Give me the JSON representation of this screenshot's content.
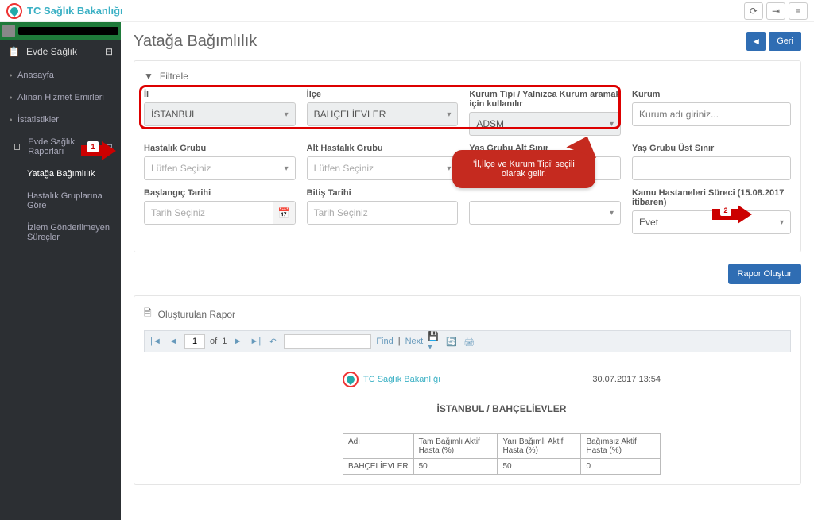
{
  "brand": "TC Sağlık Bakanlığı",
  "top": {
    "refresh": "⟳",
    "exit": "⇥",
    "menu": "≡"
  },
  "sidebar": {
    "section": "Evde Sağlık",
    "items": [
      "Anasayfa",
      "Alınan Hizmet Emirleri",
      "İstatistikler"
    ],
    "reports_head": "Evde Sağlık Raporları",
    "reports": [
      "Yatağa Bağımlılık",
      "Hastalık Gruplarına Göre",
      "İzlem Gönderilmeyen Süreçler"
    ]
  },
  "page": {
    "title": "Yatağa Bağımlılık",
    "back": "Geri"
  },
  "filter": {
    "head": "Filtrele",
    "il_lbl": "İl",
    "il_val": "İSTANBUL",
    "ilce_lbl": "İlçe",
    "ilce_val": "BAHÇELİEVLER",
    "tip_lbl": "Kurum Tipi / Yalnızca Kurum aramak için kullanılır",
    "tip_val": "ADSM",
    "kurum_lbl": "Kurum",
    "kurum_ph": "Kurum adı giriniz...",
    "hgrup_lbl": "Hastalık Grubu",
    "hgrup_ph": "Lütfen Seçiniz",
    "ahgrup_lbl": "Alt Hastalık Grubu",
    "ahgrup_ph": "Lütfen Seçiniz",
    "yas_alt_lbl": "Yaş Grubu Alt Sınır",
    "yas_ust_lbl": "Yaş Grubu Üst Sınır",
    "bas_lbl": "Başlangıç Tarihi",
    "bas_ph": "Tarih Seçiniz",
    "bit_lbl": "Bitiş Tarihi",
    "bit_ph": "Tarih Seçiniz",
    "kamu_lbl": "Kamu Hastaneleri Süreci (15.08.2017 itibaren)",
    "kamu_val": "Evet",
    "btn": "Rapor Oluştur"
  },
  "callout": {
    "line1": "'İl,İlçe ve Kurum Tipi' seçili",
    "line2": "olarak gelir."
  },
  "marker1": "1",
  "marker2": "2",
  "report": {
    "head": "Oluşturulan Rapor",
    "toolbar": {
      "of": "of",
      "total": "1",
      "page": "1",
      "find": "Find",
      "next": "Next"
    },
    "brand": "TC Sağlık Bakanlığı",
    "timestamp": "30.07.2017 13:54",
    "title": "İSTANBUL / BAHÇELİEVLER"
  },
  "chart_data": {
    "type": "table",
    "columns": [
      "Adı",
      "Tam Bağımlı Aktif Hasta (%)",
      "Yarı Bağımlı Aktif Hasta (%)",
      "Bağımsız Aktif Hasta (%)"
    ],
    "rows": [
      {
        "Adı": "BAHÇELİEVLER",
        "Tam Bağımlı Aktif Hasta (%)": 50,
        "Yarı Bağımlı Aktif Hasta (%)": 50,
        "Bağımsız Aktif Hasta (%)": 0
      }
    ]
  }
}
